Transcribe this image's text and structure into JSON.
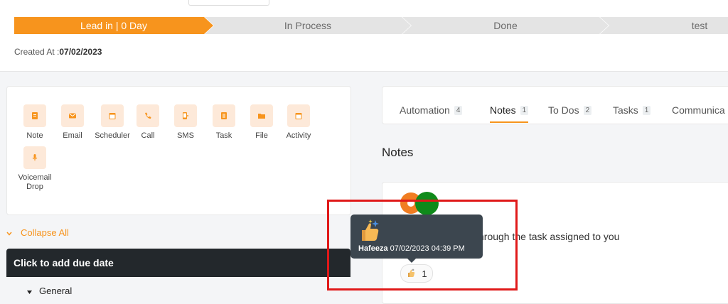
{
  "pipeline": {
    "stages": [
      {
        "label": "Lead in | 0 Day",
        "active": true
      },
      {
        "label": "In Process",
        "active": false
      },
      {
        "label": "Done",
        "active": false
      },
      {
        "label": "test",
        "active": false
      }
    ],
    "created_prefix": "Created At :",
    "created_date": "07/02/2023"
  },
  "actions": [
    {
      "label": "Note",
      "icon": "note-icon"
    },
    {
      "label": "Email",
      "icon": "email-icon"
    },
    {
      "label": "Scheduler",
      "icon": "calendar-icon"
    },
    {
      "label": "Call",
      "icon": "phone-icon"
    },
    {
      "label": "SMS",
      "icon": "sms-icon"
    },
    {
      "label": "Task",
      "icon": "task-icon"
    },
    {
      "label": "File",
      "icon": "folder-icon"
    },
    {
      "label": "Activity",
      "icon": "calendar-icon"
    },
    {
      "label": "Voicemail Drop",
      "icon": "microphone-icon"
    }
  ],
  "collapse_label": "Collapse All",
  "due_date_label": "Click to add due date",
  "general_label": "General",
  "tabs": [
    {
      "label": "Automation",
      "count": "4",
      "active": false
    },
    {
      "label": "Notes",
      "count": "1",
      "active": true
    },
    {
      "label": "To Dos",
      "count": "2",
      "active": false
    },
    {
      "label": "Tasks",
      "count": "1",
      "active": false
    },
    {
      "label": "Communica",
      "count": "",
      "active": false
    }
  ],
  "notes_heading": "Notes",
  "note": {
    "text": "hrough the task assigned to you",
    "reaction_emoji": "thumbs-up-sparkle",
    "reaction_count": "1"
  },
  "tooltip": {
    "name": "Hafeeza",
    "datetime": "07/02/2023 04:39 PM"
  },
  "colors": {
    "accent": "#f7941d",
    "dark_bar": "#23282c",
    "tooltip_bg": "#3c464f",
    "highlight": "#e01919",
    "avatar_orange": "#f07d22",
    "avatar_green": "#0f8a1a"
  }
}
